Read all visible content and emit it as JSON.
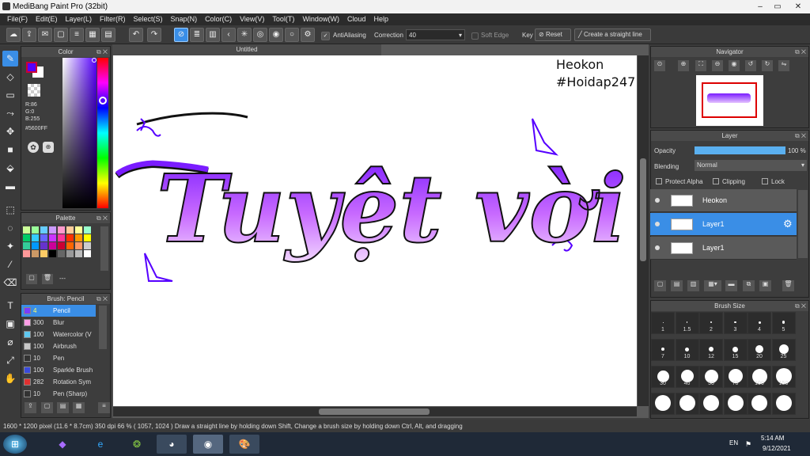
{
  "window": {
    "title": "MediBang Paint Pro (32bit)",
    "min": "–",
    "max": "▭",
    "close": "✕"
  },
  "menu": [
    "File(F)",
    "Edit(E)",
    "Layer(L)",
    "Filter(R)",
    "Select(S)",
    "Snap(N)",
    "Color(C)",
    "View(V)",
    "Tool(T)",
    "Window(W)",
    "Cloud",
    "Help"
  ],
  "toolbar": {
    "antialias_label": "AntiAliasing",
    "correction_label": "Correction",
    "correction_value": "40",
    "soft_edge_label": "Soft Edge",
    "key_label": "Key",
    "reset_label": "Reset",
    "straight_label": "Create a straight line"
  },
  "document": {
    "tab": "Untitled",
    "watermark_line1": "Heokon",
    "watermark_line2": "#Hoidap247",
    "art_text": "Tuyệt vời"
  },
  "color_panel": {
    "title": "Color",
    "r": "R:86",
    "g": "G:0",
    "b": "B:255",
    "hex": "#5600FF",
    "accent": "#5600FF"
  },
  "palette_panel": {
    "title": "Palette",
    "more": "---"
  },
  "brush_panel": {
    "title": "Brush: Pencil",
    "brushes": [
      {
        "size": "4",
        "name": "Pencil",
        "color": "#7a3cff",
        "selected": true
      },
      {
        "size": "300",
        "name": "Blur",
        "color": "#ff9ee6",
        "selected": false
      },
      {
        "size": "100",
        "name": "Watercolor (V",
        "color": "#5fc8f0",
        "selected": false
      },
      {
        "size": "100",
        "name": "Airbrush",
        "color": "#c8c8c8",
        "selected": false
      },
      {
        "size": "10",
        "name": "Pen",
        "color": "#333333",
        "selected": false
      },
      {
        "size": "100",
        "name": "Sparkle Brush",
        "color": "#3a4bdc",
        "selected": false
      },
      {
        "size": "282",
        "name": "Rotation Sym",
        "color": "#e03030",
        "selected": false
      },
      {
        "size": "10",
        "name": "Pen (Sharp)",
        "color": "#333333",
        "selected": false
      }
    ]
  },
  "navigator": {
    "title": "Navigator"
  },
  "layer_panel": {
    "title": "Layer",
    "opacity_label": "Opacity",
    "opacity_value": "100 %",
    "opacity_fraction": 1.0,
    "blending_label": "Blending",
    "blending_value": "Normal",
    "protect_alpha": "Protect Alpha",
    "clipping": "Clipping",
    "lock": "Lock",
    "layers": [
      {
        "name": "Heokon",
        "selected": false
      },
      {
        "name": "Layer1",
        "selected": true
      },
      {
        "name": "Layer1",
        "selected": false
      }
    ]
  },
  "brush_size_panel": {
    "title": "Brush Size",
    "sizes": [
      "1",
      "1.5",
      "2",
      "3",
      "4",
      "5",
      "7",
      "10",
      "12",
      "15",
      "20",
      "25",
      "30",
      "40",
      "50",
      "70",
      "100",
      "150",
      "",
      "",
      "",
      "",
      "",
      ""
    ]
  },
  "status": {
    "text": "1600 * 1200 pixel  (11.6 * 8.7cm)  350 dpi  66 %  ( 1057, 1024 )  Draw a straight line by holding down Shift, Change a brush size by holding down Ctrl, Alt, and dragging"
  },
  "taskbar": {
    "lang": "EN",
    "time": "5:14 AM",
    "date": "9/12/2021"
  }
}
